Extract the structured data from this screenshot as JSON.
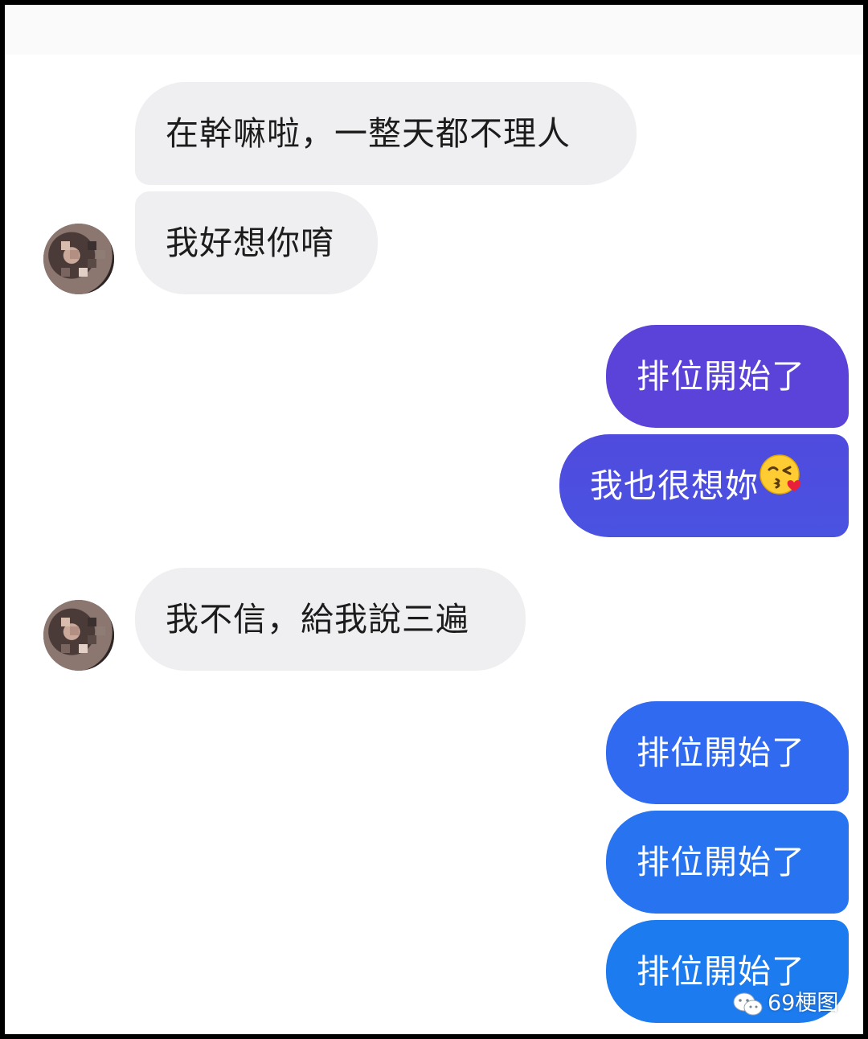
{
  "colors": {
    "incoming_bubble": "#efeff1",
    "outgoing_bubble_purple": "#5b43d9",
    "outgoing_bubble_blue": "#2f6af0",
    "outgoing_bubble_bright_blue": "#1d7bf0",
    "outgoing_text": "#ffffff",
    "incoming_text": "#1c1c1c"
  },
  "messages": [
    {
      "direction": "incoming",
      "text": "在幹嘛啦，一整天都不理人"
    },
    {
      "direction": "incoming",
      "text": "我好想你唷",
      "avatar": "blurred-avatar"
    },
    {
      "direction": "outgoing",
      "text": "排位開始了"
    },
    {
      "direction": "outgoing",
      "text": "我也很想妳",
      "emoji": "kissing-face-wink-heart-icon"
    },
    {
      "direction": "incoming",
      "text": "我不信，給我說三遍",
      "avatar": "blurred-avatar"
    },
    {
      "direction": "outgoing",
      "text": "排位開始了"
    },
    {
      "direction": "outgoing",
      "text": "排位開始了"
    },
    {
      "direction": "outgoing",
      "text": "排位開始了"
    }
  ],
  "watermark": {
    "icon": "wechat-icon",
    "text": "69梗图"
  }
}
